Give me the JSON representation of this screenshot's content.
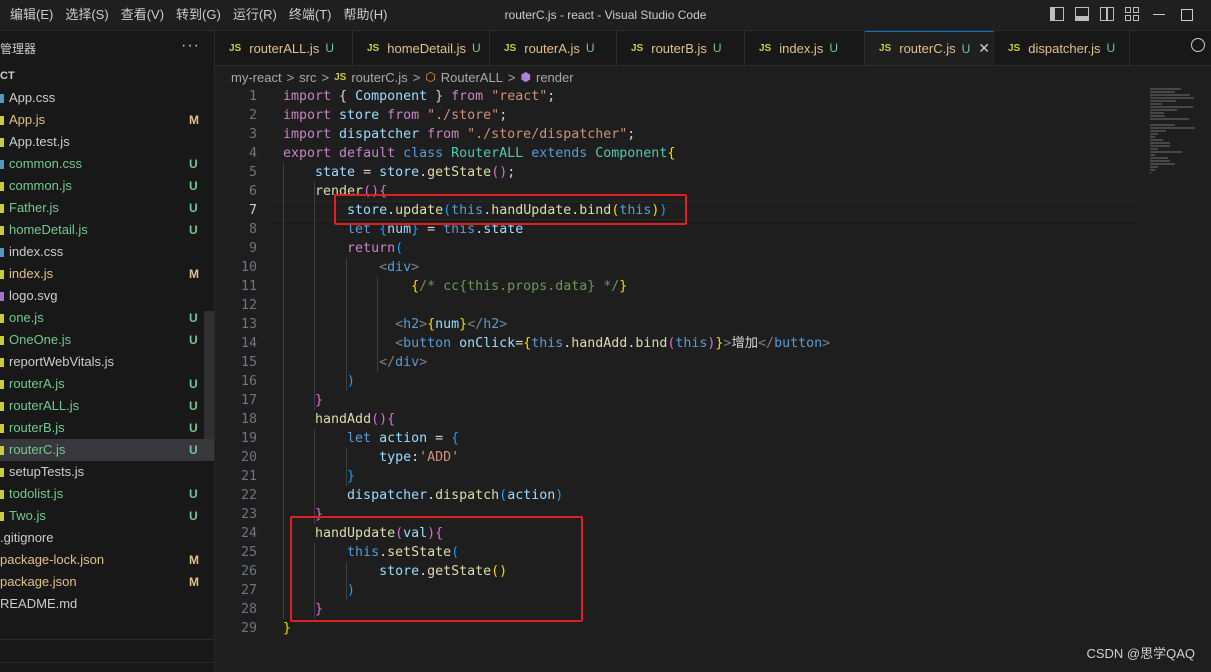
{
  "window": {
    "title": "routerC.js - react - Visual Studio Code",
    "menu": [
      "编辑(E)",
      "选择(S)",
      "查看(V)",
      "转到(G)",
      "运行(R)",
      "终端(T)",
      "帮助(H)"
    ]
  },
  "sidebar": {
    "header": "管理器",
    "more": "···",
    "project": "CT",
    "files": [
      {
        "name": "App.css",
        "status": "",
        "type": "css",
        "color": "w"
      },
      {
        "name": "App.js",
        "status": "M",
        "type": "js",
        "color": "m"
      },
      {
        "name": "App.test.js",
        "status": "",
        "type": "js",
        "color": "w"
      },
      {
        "name": "common.css",
        "status": "U",
        "type": "css",
        "color": "u"
      },
      {
        "name": "common.js",
        "status": "U",
        "type": "js",
        "color": "u"
      },
      {
        "name": "Father.js",
        "status": "U",
        "type": "js",
        "color": "u"
      },
      {
        "name": "homeDetail.js",
        "status": "U",
        "type": "js",
        "color": "u"
      },
      {
        "name": "index.css",
        "status": "",
        "type": "css",
        "color": "w"
      },
      {
        "name": "index.js",
        "status": "M",
        "type": "js",
        "color": "m"
      },
      {
        "name": "logo.svg",
        "status": "",
        "type": "svg",
        "color": "w"
      },
      {
        "name": "one.js",
        "status": "U",
        "type": "js",
        "color": "u"
      },
      {
        "name": "OneOne.js",
        "status": "U",
        "type": "js",
        "color": "u"
      },
      {
        "name": "reportWebVitals.js",
        "status": "",
        "type": "js",
        "color": "w"
      },
      {
        "name": "routerA.js",
        "status": "U",
        "type": "js",
        "color": "u"
      },
      {
        "name": "routerALL.js",
        "status": "U",
        "type": "js",
        "color": "u"
      },
      {
        "name": "routerB.js",
        "status": "U",
        "type": "js",
        "color": "u"
      },
      {
        "name": "routerC.js",
        "status": "U",
        "type": "js",
        "color": "u",
        "selected": true
      },
      {
        "name": "setupTests.js",
        "status": "",
        "type": "js",
        "color": "w"
      },
      {
        "name": "todolist.js",
        "status": "U",
        "type": "js",
        "color": "u"
      },
      {
        "name": "Two.js",
        "status": "U",
        "type": "js",
        "color": "u"
      },
      {
        "name": ".gitignore",
        "status": "",
        "type": "none",
        "color": "w"
      },
      {
        "name": "package-lock.json",
        "status": "M",
        "type": "none",
        "color": "m"
      },
      {
        "name": "package.json",
        "status": "M",
        "type": "none",
        "color": "m"
      },
      {
        "name": "README.md",
        "status": "",
        "type": "none",
        "color": "w"
      }
    ]
  },
  "tabs": [
    {
      "icon": "JS",
      "name": "routerALL.js",
      "status": "U"
    },
    {
      "icon": "JS",
      "name": "homeDetail.js",
      "status": "U"
    },
    {
      "icon": "JS",
      "name": "routerA.js",
      "status": "U"
    },
    {
      "icon": "JS",
      "name": "routerB.js",
      "status": "U"
    },
    {
      "icon": "JS",
      "name": "index.js",
      "status": "U"
    },
    {
      "icon": "JS",
      "name": "routerC.js",
      "status": "U",
      "active": true,
      "close": "✕"
    },
    {
      "icon": "JS",
      "name": "dispatcher.js",
      "status": "U"
    }
  ],
  "breadcrumb": {
    "items": [
      "my-react",
      "src",
      "routerC.js",
      "RouterALL",
      "render"
    ],
    "separator": ">",
    "js_icon": "JS"
  },
  "editor": {
    "current_line": 7,
    "lines": [
      [
        [
          "k",
          "import "
        ],
        [
          "t",
          "{ "
        ],
        [
          "v",
          "Component"
        ],
        [
          "t",
          " } "
        ],
        [
          "k",
          "from "
        ],
        [
          "s",
          "\"react\""
        ],
        [
          "t",
          ";"
        ]
      ],
      [
        [
          "k",
          "import "
        ],
        [
          "v",
          "store "
        ],
        [
          "k",
          "from "
        ],
        [
          "s",
          "\"./store\""
        ],
        [
          "t",
          ";"
        ]
      ],
      [
        [
          "k",
          "import "
        ],
        [
          "v",
          "dispatcher "
        ],
        [
          "k",
          "from "
        ],
        [
          "s",
          "\"./store/dispatcher\""
        ],
        [
          "t",
          ";"
        ]
      ],
      [
        [
          "k",
          "export "
        ],
        [
          "k",
          "default "
        ],
        [
          "b",
          "class "
        ],
        [
          "cn",
          "RouterALL "
        ],
        [
          "b",
          "extends "
        ],
        [
          "cn",
          "Component"
        ],
        [
          "y",
          "{"
        ]
      ],
      [
        [
          "t",
          "    "
        ],
        [
          "v",
          "state "
        ],
        [
          "t",
          "= "
        ],
        [
          "v",
          "store"
        ],
        [
          "t",
          "."
        ],
        [
          "f",
          "getState"
        ],
        [
          "p",
          "()"
        ],
        [
          "t",
          ";"
        ]
      ],
      [
        [
          "t",
          "    "
        ],
        [
          "f",
          "render"
        ],
        [
          "p",
          "(){"
        ]
      ],
      [
        [
          "t",
          "        "
        ],
        [
          "v",
          "store"
        ],
        [
          "t",
          "."
        ],
        [
          "f",
          "update"
        ],
        [
          "bl",
          "("
        ],
        [
          "b",
          "this"
        ],
        [
          "t",
          "."
        ],
        [
          "f",
          "handUpdate"
        ],
        [
          "t",
          "."
        ],
        [
          "f",
          "bind"
        ],
        [
          "y",
          "("
        ],
        [
          "b",
          "this"
        ],
        [
          "y",
          ")"
        ],
        [
          "bl",
          ")"
        ]
      ],
      [
        [
          "t",
          "        "
        ],
        [
          "b",
          "let "
        ],
        [
          "bl",
          "{"
        ],
        [
          "v",
          "num"
        ],
        [
          "bl",
          "} "
        ],
        [
          "t",
          "= "
        ],
        [
          "b",
          "this"
        ],
        [
          "t",
          "."
        ],
        [
          "v",
          "state"
        ]
      ],
      [
        [
          "t",
          "        "
        ],
        [
          "k",
          "return"
        ],
        [
          "bl",
          "("
        ]
      ],
      [
        [
          "t",
          "            "
        ],
        [
          "tg",
          "<"
        ],
        [
          "tgn",
          "div"
        ],
        [
          "tg",
          ">"
        ]
      ],
      [
        [
          "t",
          "                "
        ],
        [
          "y",
          "{"
        ],
        [
          "cm",
          "/* cc{this.props.data} */"
        ],
        [
          "y",
          "}"
        ]
      ],
      [],
      [
        [
          "t",
          "              "
        ],
        [
          "tg",
          "<"
        ],
        [
          "tgn",
          "h2"
        ],
        [
          "tg",
          ">"
        ],
        [
          "y",
          "{"
        ],
        [
          "v",
          "num"
        ],
        [
          "y",
          "}"
        ],
        [
          "tg",
          "</"
        ],
        [
          "tgn",
          "h2"
        ],
        [
          "tg",
          ">"
        ]
      ],
      [
        [
          "t",
          "              "
        ],
        [
          "tg",
          "<"
        ],
        [
          "tgn",
          "button "
        ],
        [
          "v",
          "onClick"
        ],
        [
          "t",
          "="
        ],
        [
          "y",
          "{"
        ],
        [
          "b",
          "this"
        ],
        [
          "t",
          "."
        ],
        [
          "f",
          "handAdd"
        ],
        [
          "t",
          "."
        ],
        [
          "f",
          "bind"
        ],
        [
          "p",
          "("
        ],
        [
          "b",
          "this"
        ],
        [
          "p",
          ")"
        ],
        [
          "y",
          "}"
        ],
        [
          "tg",
          ">"
        ],
        [
          "t",
          "增加"
        ],
        [
          "tg",
          "</"
        ],
        [
          "tgn",
          "button"
        ],
        [
          "tg",
          ">"
        ]
      ],
      [
        [
          "t",
          "            "
        ],
        [
          "tg",
          "</"
        ],
        [
          "tgn",
          "div"
        ],
        [
          "tg",
          ">"
        ]
      ],
      [
        [
          "t",
          "        "
        ],
        [
          "bl",
          ")"
        ]
      ],
      [
        [
          "t",
          "    "
        ],
        [
          "p",
          "}"
        ]
      ],
      [
        [
          "t",
          "    "
        ],
        [
          "f",
          "handAdd"
        ],
        [
          "p",
          "(){"
        ]
      ],
      [
        [
          "t",
          "        "
        ],
        [
          "b",
          "let "
        ],
        [
          "v",
          "action "
        ],
        [
          "t",
          "= "
        ],
        [
          "bl",
          "{"
        ]
      ],
      [
        [
          "t",
          "            "
        ],
        [
          "v",
          "type"
        ],
        [
          "t",
          ":"
        ],
        [
          "s",
          "'ADD'"
        ]
      ],
      [
        [
          "t",
          "        "
        ],
        [
          "bl",
          "}"
        ]
      ],
      [
        [
          "t",
          "        "
        ],
        [
          "v",
          "dispatcher"
        ],
        [
          "t",
          "."
        ],
        [
          "f",
          "dispatch"
        ],
        [
          "bl",
          "("
        ],
        [
          "v",
          "action"
        ],
        [
          "bl",
          ")"
        ]
      ],
      [
        [
          "t",
          "    "
        ],
        [
          "p",
          "}"
        ]
      ],
      [
        [
          "t",
          "    "
        ],
        [
          "f",
          "handUpdate"
        ],
        [
          "p",
          "("
        ],
        [
          "v",
          "val"
        ],
        [
          "p",
          ")"
        ],
        [
          "p",
          "{"
        ]
      ],
      [
        [
          "t",
          "        "
        ],
        [
          "b",
          "this"
        ],
        [
          "t",
          "."
        ],
        [
          "f",
          "setState"
        ],
        [
          "bl",
          "("
        ]
      ],
      [
        [
          "t",
          "            "
        ],
        [
          "v",
          "store"
        ],
        [
          "t",
          "."
        ],
        [
          "f",
          "getState"
        ],
        [
          "y",
          "()"
        ]
      ],
      [
        [
          "t",
          "        "
        ],
        [
          "bl",
          ")"
        ]
      ],
      [
        [
          "t",
          "    "
        ],
        [
          "p",
          "}"
        ]
      ],
      [
        [
          "y",
          "}"
        ]
      ]
    ]
  },
  "watermark": "CSDN @思学QAQ",
  "window_controls": {
    "minimize": "—",
    "maximize": "☐"
  }
}
